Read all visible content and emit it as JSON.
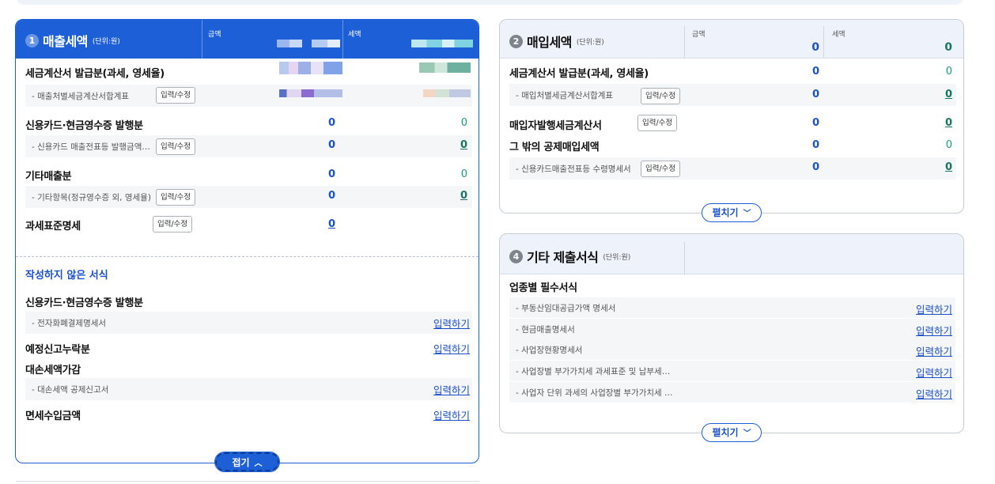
{
  "sales_tax": {
    "number": "1",
    "title": "매출세액",
    "unit": "(단위:원)",
    "col_amount": "금액",
    "col_tax": "세액",
    "rows": {
      "invoice_issued": {
        "label": "세금계산서 발급분(과세, 영세율)"
      },
      "invoice_summary": {
        "label": "- 매출처별세금계산서합계표",
        "button": "입력/수정"
      },
      "card_receipt": {
        "label": "신용카드·현금영수증 발행분",
        "amount": "0",
        "tax": "0"
      },
      "card_sub": {
        "label": "- 신용카드 매출전표등 발행금액…",
        "button": "입력/수정",
        "amount": "0",
        "tax": "0"
      },
      "other_sales": {
        "label": "기타매출분",
        "amount": "0",
        "tax": "0"
      },
      "other_sub": {
        "label": "- 기타항목(정규영수증 외, 영세율)",
        "button": "입력/수정",
        "amount": "0",
        "tax": "0"
      },
      "tax_base": {
        "label": "과세표준명세",
        "button": "입력/수정",
        "amount": "0"
      }
    },
    "unfilled_title": "작성하지 않은 서식",
    "unfilled": {
      "card_receipt": {
        "label": "신용카드·현금영수증 발행분"
      },
      "e_money": {
        "label": "- 전자화폐결제명세서",
        "link": "입력하기"
      },
      "scheduled_omission": {
        "label": "예정신고누락분",
        "link": "입력하기"
      },
      "bad_debt": {
        "label": "대손세액가감"
      },
      "bad_debt_sub": {
        "label": "- 대손세액 공제신고서",
        "link": "입력하기"
      },
      "exempt_import": {
        "label": "면세수입금액",
        "link": "입력하기"
      }
    },
    "collapse_label": "접기"
  },
  "purchase_tax": {
    "number": "2",
    "title": "매입세액",
    "unit": "(단위:원)",
    "col_amount": "금액",
    "col_tax": "세액",
    "total_amount": "0",
    "total_tax": "0",
    "rows": {
      "invoice_received": {
        "label": "세금계산서 발급분(과세, 영세율)",
        "amount": "0",
        "tax": "0"
      },
      "invoice_summary": {
        "label": "- 매입처별세금계산서합계표",
        "button": "입력/수정",
        "amount": "0",
        "tax": "0"
      },
      "buyer_issued": {
        "label": "매입자발행세금계산서",
        "button": "입력/수정",
        "amount": "0",
        "tax": "0"
      },
      "other_deduction": {
        "label": "그 밖의 공제매입세액",
        "amount": "0",
        "tax": "0"
      },
      "card_sub": {
        "label": "- 신용카드매출전표등 수령명세서",
        "button": "입력/수정",
        "amount": "0",
        "tax": "0"
      }
    },
    "expand_label": "펼치기"
  },
  "other_forms": {
    "number": "4",
    "title": "기타 제출서식",
    "unit": "(단위:원)",
    "section_label": "업종별 필수서식",
    "items": [
      {
        "label": "- 부동산임대공급가액 명세서",
        "link": "입력하기"
      },
      {
        "label": "- 현금매출명세서",
        "link": "입력하기"
      },
      {
        "label": "- 사업장현황명세서",
        "link": "입력하기"
      },
      {
        "label": "- 사업장별 부가가치세 과세표준 및 납부세…",
        "link": "입력하기"
      },
      {
        "label": "- 사업자 단위 과세의 사업장별 부가가치세 …",
        "link": "입력하기"
      }
    ],
    "expand_label": "펼치기"
  },
  "colors": {
    "primary": "#1d5fd6",
    "value_blue": "#1b52c9",
    "value_green": "#169e80",
    "header_light": "#eef3fb"
  }
}
